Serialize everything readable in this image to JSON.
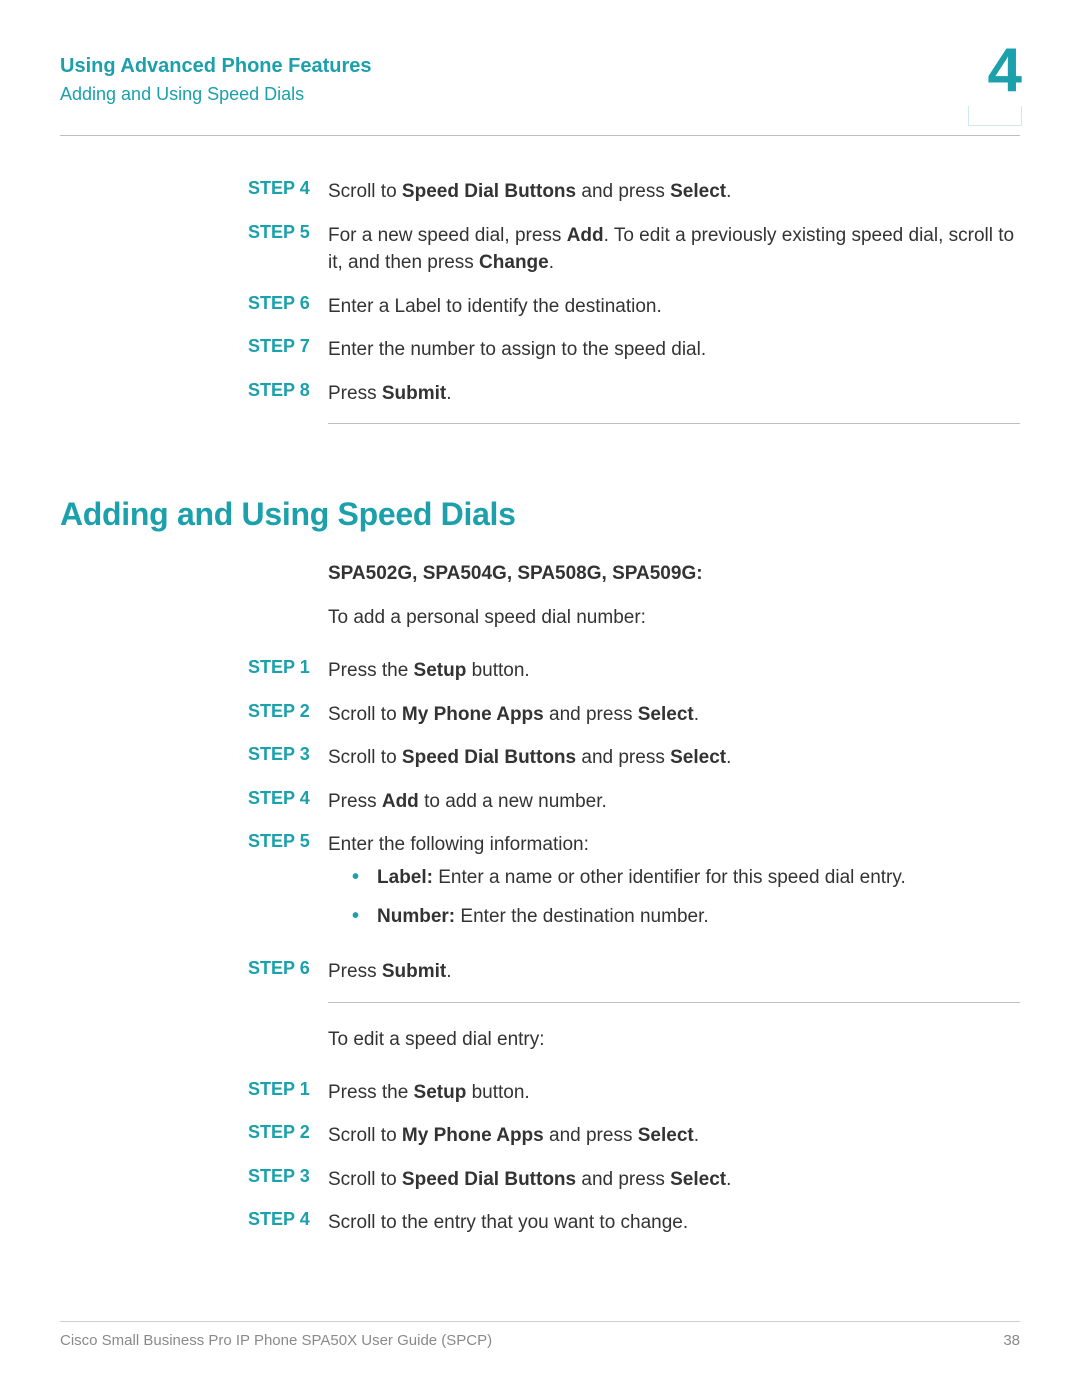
{
  "header": {
    "title": "Using Advanced Phone Features",
    "subtitle": "Adding and Using Speed Dials",
    "chapter": "4"
  },
  "topSteps": [
    {
      "label": "STEP 4",
      "parts": [
        {
          "t": "Scroll to "
        },
        {
          "t": "Speed Dial Buttons",
          "b": true
        },
        {
          "t": " and press "
        },
        {
          "t": "Select",
          "b": true
        },
        {
          "t": "."
        }
      ]
    },
    {
      "label": "STEP 5",
      "parts": [
        {
          "t": "For a new speed dial, press "
        },
        {
          "t": "Add",
          "b": true
        },
        {
          "t": ". To edit a previously existing speed dial, scroll to it, and then press "
        },
        {
          "t": "Change",
          "b": true
        },
        {
          "t": "."
        }
      ]
    },
    {
      "label": "STEP 6",
      "parts": [
        {
          "t": "Enter a Label to identify the destination."
        }
      ]
    },
    {
      "label": "STEP 7",
      "parts": [
        {
          "t": "Enter the number to assign to the speed dial."
        }
      ]
    },
    {
      "label": "STEP 8",
      "parts": [
        {
          "t": "Press "
        },
        {
          "t": "Submit",
          "b": true
        },
        {
          "t": "."
        }
      ]
    }
  ],
  "sectionHeading": "Adding and Using Speed Dials",
  "modelsHeading": "SPA502G, SPA504G, SPA508G, SPA509G:",
  "introAdd": "To add a personal speed dial number:",
  "addSteps": [
    {
      "label": "STEP 1",
      "parts": [
        {
          "t": "Press the "
        },
        {
          "t": "Setup",
          "b": true
        },
        {
          "t": " button."
        }
      ]
    },
    {
      "label": "STEP 2",
      "parts": [
        {
          "t": "Scroll to "
        },
        {
          "t": "My Phone Apps",
          "b": true
        },
        {
          "t": " and press "
        },
        {
          "t": "Select",
          "b": true
        },
        {
          "t": "."
        }
      ]
    },
    {
      "label": "STEP 3",
      "parts": [
        {
          "t": "Scroll to "
        },
        {
          "t": "Speed Dial Buttons",
          "b": true
        },
        {
          "t": " and press "
        },
        {
          "t": "Select",
          "b": true
        },
        {
          "t": "."
        }
      ]
    },
    {
      "label": "STEP 4",
      "parts": [
        {
          "t": "Press "
        },
        {
          "t": "Add",
          "b": true
        },
        {
          "t": " to add a new number."
        }
      ]
    },
    {
      "label": "STEP 5",
      "parts": [
        {
          "t": "Enter the following information:"
        }
      ],
      "bullets": [
        [
          {
            "t": "Label:",
            "b": true
          },
          {
            "t": " Enter a name or other identifier for this speed dial entry."
          }
        ],
        [
          {
            "t": "Number:",
            "b": true
          },
          {
            "t": " Enter the destination number."
          }
        ]
      ]
    },
    {
      "label": "STEP 6",
      "parts": [
        {
          "t": "Press "
        },
        {
          "t": "Submit",
          "b": true
        },
        {
          "t": "."
        }
      ]
    }
  ],
  "introEdit": "To edit a speed dial entry:",
  "editSteps": [
    {
      "label": "STEP 1",
      "parts": [
        {
          "t": "Press the "
        },
        {
          "t": "Setup",
          "b": true
        },
        {
          "t": " button."
        }
      ]
    },
    {
      "label": "STEP 2",
      "parts": [
        {
          "t": "Scroll to "
        },
        {
          "t": "My Phone Apps",
          "b": true
        },
        {
          "t": " and press "
        },
        {
          "t": "Select",
          "b": true
        },
        {
          "t": "."
        }
      ]
    },
    {
      "label": "STEP 3",
      "parts": [
        {
          "t": "Scroll to "
        },
        {
          "t": "Speed Dial Buttons",
          "b": true
        },
        {
          "t": " and press "
        },
        {
          "t": "Select",
          "b": true
        },
        {
          "t": "."
        }
      ]
    },
    {
      "label": "STEP 4",
      "parts": [
        {
          "t": "Scroll to the entry that you want to change."
        }
      ]
    }
  ],
  "footer": {
    "left": "Cisco Small Business Pro IP Phone SPA50X User Guide (SPCP)",
    "right": "38"
  }
}
